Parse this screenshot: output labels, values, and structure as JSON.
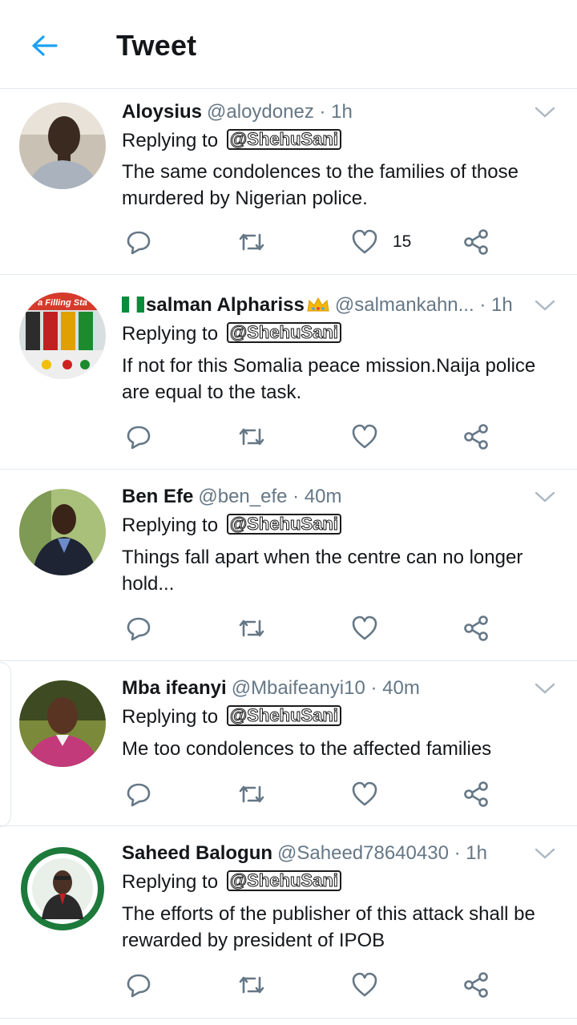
{
  "header": {
    "title": "Tweet",
    "back_icon": "arrow-left-icon",
    "accent": "#1da1f2"
  },
  "tweets": [
    {
      "name": "Aloysius",
      "handle": "@aloydonez",
      "time": "· 1h",
      "replying_label": "Replying to",
      "mention": "@ShehuSani",
      "text": "The same condolences to the families of those murdered by Nigerian police.",
      "like_count": "15"
    },
    {
      "name": "salman Alphariss",
      "handle": "@salmankahn...",
      "time": "· 1h",
      "replying_label": "Replying to",
      "mention": "@ShehuSani",
      "text": "If not for this Somalia peace mission.Naija police are equal to the task.",
      "like_count": "",
      "avatar_text": "a Filling Sta"
    },
    {
      "name": "Ben Efe",
      "handle": "@ben_efe",
      "time": "· 40m",
      "replying_label": "Replying to",
      "mention": "@ShehuSani",
      "text": "Things fall apart when the centre can no longer hold...",
      "like_count": ""
    },
    {
      "name": "Mba ifeanyi",
      "handle": "@Mbaifeanyi10",
      "time": "· 40m",
      "replying_label": "Replying to",
      "mention": "@ShehuSani",
      "text": "Me too condolences to the affected families",
      "like_count": ""
    },
    {
      "name": "Saheed Balogun",
      "handle": "@Saheed78640430",
      "time": "· 1h",
      "replying_label": "Replying to",
      "mention": "@ShehuSani",
      "text": "The efforts of the publisher of this attack shall be rewarded by president of IPOB",
      "like_count": ""
    }
  ]
}
